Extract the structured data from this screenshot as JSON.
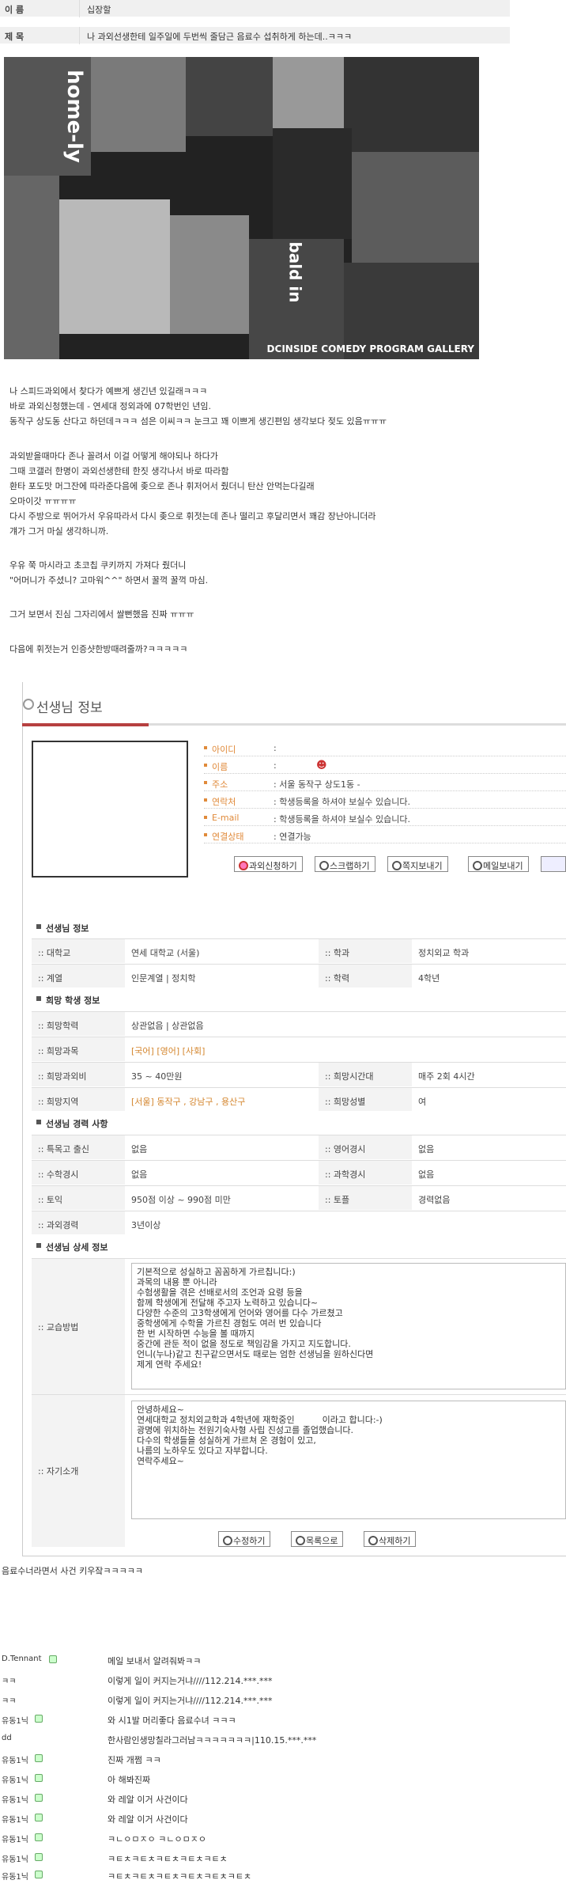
{
  "header": {
    "name_label": "이 름",
    "name_value": "십장할",
    "title_label": "제 목",
    "title_value": "나 과외선생한테 일주일에 두번씩 줄담근 음료수 섭취하게 하는데..ㅋㅋㅋ"
  },
  "collage": {
    "watermark": "DCINSIDE COMEDY PROGRAM GALLERY",
    "vertical_text_1": "home-ly",
    "vertical_text_2": "bald in"
  },
  "post": {
    "lines": [
      "나 스피드과외에서 찾다가 예쁘게 생긴년 있길래ㅋㅋㅋ",
      "바로 과외신청했는데 - 연세대 정외과에 07학번인 년임.",
      "동작구 상도동 산다고 하던데ㅋㅋㅋ 섬은 이씨ㅋㅋ 눈크고 꽤 이쁘게 생긴편임 생각보다 젖도  있음ㅠㅠㅠ",
      "과외받을때마다 존나 꼴려서 이걸 어떻게 해야되나 하다가",
      "그때 코갤러 한명이 과외선생한테 한짓 생각나서 바로 따라함",
      "환타 포도맛 머그잔에 따라준다음에 좆으로 존나 휘저어서 줬더니 탄산 안먹는다길래",
      "오마이갓 ㅠㅠㅠㅠ",
      "다시 주방으로 뛰어가서 우유따라서 다시 좆으로 휘젓는데 존나 떨리고 후달리면서 꽤감 장난아니더라",
      "걔가 그거 마실 생각하니까.",
      "우유 쭉 마시라고 초코칩 쿠키까지 가져다 줬더니",
      "\"어머니가 주셨니? 고마워^^\" 하면서 꿀꺽 꿀꺽 마심.",
      "그거 보면서 진심 그자리에서 쌀뻔했음 진짜 ㅠㅠㅠ",
      "다음에 휘젓는거 인증샷한방때려줄까?ㅋㅋㅋㅋㅋ"
    ]
  },
  "panel": {
    "title": "선생님 정보",
    "info": [
      {
        "label": "아이디",
        "value": ":"
      },
      {
        "label": "이름",
        "value": ":"
      },
      {
        "label": "주소",
        "value": ": 서울 동작구 상도1동 -"
      },
      {
        "label": "연락처",
        "value": ": 학생등록을 하셔야 보실수 있습니다."
      },
      {
        "label": "E-mail",
        "value": ": 학생등록을 하셔야 보실수 있습니다."
      },
      {
        "label": "연결상태",
        "value": ": 연결가능"
      }
    ],
    "buttons": [
      "과외신청하기",
      "스크랩하기",
      "쪽지보내기",
      "메일보내기"
    ],
    "sections": {
      "teacher_info": "선생님 정보",
      "desired_student": "희망 학생 정보",
      "career": "선생님 경력 사항",
      "detail": "선생님 상세 정보"
    },
    "rows": {
      "univ_label": ":: 대학교",
      "univ_value": "연세 대학교 (서울)",
      "dept_label": ":: 학과",
      "dept_value": "정치외교 학과",
      "field_label": ":: 계열",
      "field_value": "인문계열 | 정치학",
      "year_label": ":: 학력",
      "year_value": "4학년",
      "grade_label": ":: 희망학력",
      "grade_value": "상관없음 | 상관없음",
      "subject_label": ":: 희망과목",
      "subject_value": "[국어] [영어] [사회]",
      "fee_label": ":: 희망과외비",
      "fee_value": "35 ~ 40만원",
      "time_label": ":: 희망시간대",
      "time_value": "매주 2회 4시간",
      "region_label": ":: 희망지역",
      "region_value": "[서울] 동작구 , 강남구 , 용산구",
      "gender_label": ":: 희망성별",
      "gender_value": "여",
      "special_label": ":: 특목고 출신",
      "special_value": "없음",
      "eng_label": ":: 영어경시",
      "eng_value": "없음",
      "math_label": ":: 수학경시",
      "math_value": "없음",
      "sci_label": ":: 과학경시",
      "sci_value": "없음",
      "toeic_label": ":: 토익",
      "toeic_value": "950점 이상 ~ 990점 미만",
      "toefl_label": ":: 토플",
      "toefl_value": "경력없음",
      "exp_label": ":: 과외경력",
      "exp_value": "3년이상",
      "method_label": ":: 교습방법",
      "method_text": "기본적으로 성실하고 꼼꼼하게 가르칩니다:)\n과목의 내용 뿐 아니라\n수험생활을 겪은 선배로서의 조언과 요령 등을\n함께 학생에게 전달해 주고자 노력하고 있습니다~\n다양한 수준의 고3학생에게 언어와 영어를 다수 가르쳤고\n중학생에게 수학을 가르친 경험도 여러 번 있습니다\n한 번 시작하면 수능을 볼 때까지\n중간에 관둔 적이 없을 정도로 책임감을 가지고 지도합니다.\n언니(누나)같고 친구같으면서도 때로는 엄한 선생님을 원하신다면\n제게 연락 주세요!",
      "intro_label": ":: 자기소개",
      "intro_text": "안녕하세요~\n연세대학교 정치외교학과 4학년에 재학중인          이라고 합니다:-)\n광명에 위치하는 전원기숙사형 사립 진성고를 졸업했습니다.\n다수의 학생들을 성실하게 가르쳐 온 경험이 있고,\n나름의 노하우도 있다고 자부합니다.\n연락주세요~"
    },
    "bottom_buttons": [
      "수정하기",
      "목록으로",
      "삭제하기"
    ]
  },
  "after_text": "음료수너라면서 사건 키우잨ㅋㅋㅋㅋㅋ",
  "comments": [
    {
      "user": "D.Tennant",
      "icon": true,
      "text": "메일 보내서 알려줘봐ㅋㅋ"
    },
    {
      "user": "ㅋㅋ",
      "icon": false,
      "text": "이렇게 일이 커지는거냐////112.214.***.***"
    },
    {
      "user": "ㅋㅋ",
      "icon": false,
      "text": "이렇게 일이 커지는거냐////112.214.***.***"
    },
    {
      "user": "유동1닉",
      "icon": true,
      "text": "와 시1발 머리좋다 음료수녀 ㅋㅋㅋ"
    },
    {
      "user": "dd",
      "icon": false,
      "text": "한사람인생망칠라그러남ㅋㅋㅋㅋㅋㅋㅋ|110.15.***.***"
    },
    {
      "user": "유동1닉",
      "icon": true,
      "text": "진짜 개쩜 ㅋㅋ"
    },
    {
      "user": "유동1닉",
      "icon": true,
      "text": "아 해봐진짜"
    },
    {
      "user": "유동1닉",
      "icon": true,
      "text": "와 레알 이거 사건이다"
    },
    {
      "user": "유동1닉",
      "icon": true,
      "text": "와 레알 이거 사건이다"
    },
    {
      "user": "유동1닉",
      "icon": true,
      "text": "ㅋㄴㅇㅁㅈㅇ ㅋㄴㅇㅁㅈㅇ"
    },
    {
      "user": "유동1닉",
      "icon": true,
      "text": "ㅋㅌㅊㅋㅌㅊㅋㅌㅊㅋㅌㅊㅋㅌㅊ"
    },
    {
      "user": "유동1닉",
      "icon": true,
      "text": "ㅋㅌㅊㅋㅌㅊㅋㅌㅊㅋㅌㅊㅋㅌㅊㅋㅌㅊ"
    }
  ]
}
